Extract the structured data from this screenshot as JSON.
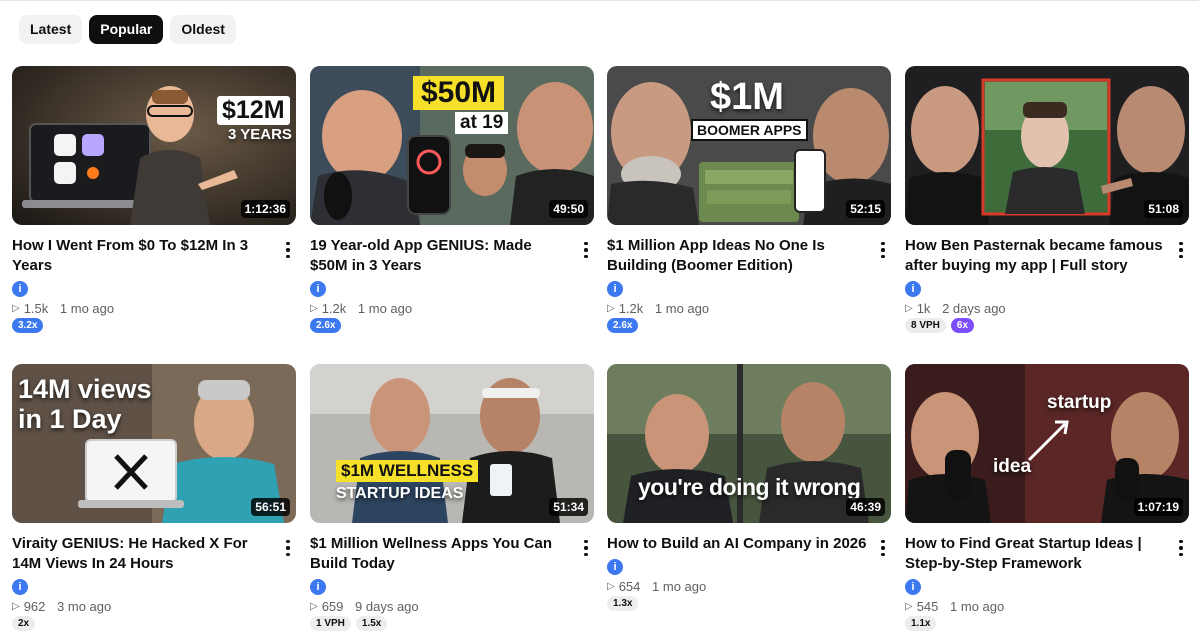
{
  "filters": {
    "latest": "Latest",
    "popular": "Popular",
    "oldest": "Oldest",
    "selected": "Popular"
  },
  "channel_icon": "i",
  "videos": [
    {
      "title": "How I Went From $0 To $12M In 3 Years",
      "duration": "1:12:36",
      "views": "1.5k",
      "age": "1 mo ago",
      "overlay": [
        "$12M",
        "3 YEARS"
      ],
      "badges": [
        {
          "text": "3.2x",
          "style": "blue"
        }
      ]
    },
    {
      "title": "19 Year-old App GENIUS: Made $50M in 3 Years",
      "duration": "49:50",
      "views": "1.2k",
      "age": "1 mo ago",
      "overlay": [
        "$50M",
        "at 19"
      ],
      "badges": [
        {
          "text": "2.6x",
          "style": "blue"
        }
      ]
    },
    {
      "title": "$1 Million App Ideas No One Is Building (Boomer Edition)",
      "duration": "52:15",
      "views": "1.2k",
      "age": "1 mo ago",
      "overlay": [
        "$1M",
        "BOOMER APPS"
      ],
      "badges": [
        {
          "text": "2.6x",
          "style": "blue"
        }
      ]
    },
    {
      "title": "How Ben Pasternak became famous after buying my app | Full story",
      "duration": "51:08",
      "views": "1k",
      "age": "2 days ago",
      "overlay": [],
      "badges": [
        {
          "text": "8 VPH",
          "style": "grey"
        },
        {
          "text": "6x",
          "style": "purple"
        }
      ]
    },
    {
      "title": "Viraity GENIUS: He Hacked X For 14M Views In 24 Hours",
      "duration": "56:51",
      "views": "962",
      "age": "3 mo ago",
      "overlay": [
        "14M views",
        "in 1 Day"
      ],
      "badges": [
        {
          "text": "2x",
          "style": "grey"
        }
      ]
    },
    {
      "title": "$1 Million Wellness Apps You Can Build Today",
      "duration": "51:34",
      "views": "659",
      "age": "9 days ago",
      "overlay": [
        "$1M WELLNESS",
        "STARTUP IDEAS"
      ],
      "badges": [
        {
          "text": "1 VPH",
          "style": "grey"
        },
        {
          "text": "1.5x",
          "style": "grey"
        }
      ]
    },
    {
      "title": "How to Build an AI Company in 2026",
      "duration": "46:39",
      "views": "654",
      "age": "1 mo ago",
      "overlay": [
        "you're doing it wrong"
      ],
      "badges": [
        {
          "text": "1.3x",
          "style": "grey"
        }
      ]
    },
    {
      "title": "How to Find Great Startup Ideas | Step-by-Step Framework",
      "duration": "1:07:19",
      "views": "545",
      "age": "1 mo ago",
      "overlay": [
        "startup",
        "idea"
      ],
      "badges": [
        {
          "text": "1.1x",
          "style": "grey"
        }
      ]
    }
  ]
}
